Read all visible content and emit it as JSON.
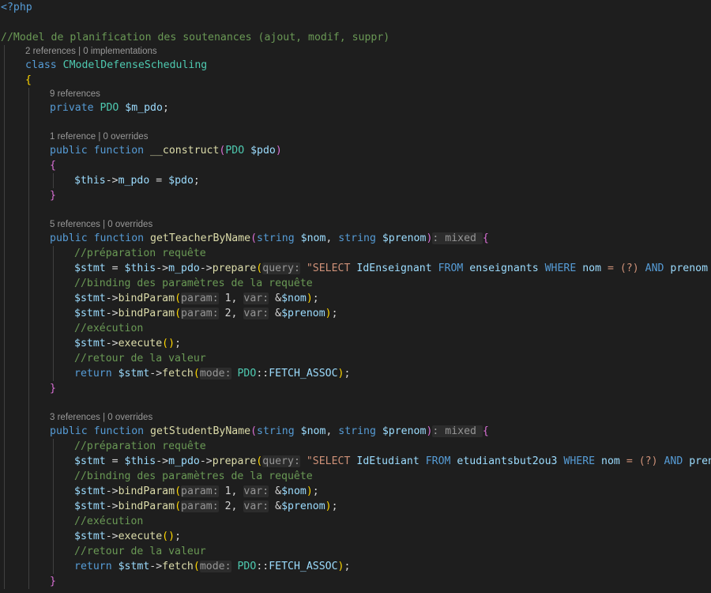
{
  "colors": {
    "background": "#1e1e1e",
    "plain": "#d4d4d4",
    "keyword": "#569cd6",
    "type": "#4ec9b0",
    "function": "#dcdcaa",
    "variable": "#9cdcfe",
    "string": "#ce9178",
    "comment": "#6a9955",
    "brace": "#ffd700",
    "paren": "#da70d6",
    "hint": "#969696",
    "lens": "#999999",
    "guide": "#404040"
  },
  "lines": [
    {
      "indent": 0,
      "kind": "code",
      "tokens": [
        {
          "t": "<?php",
          "c": "keyword"
        }
      ]
    },
    {
      "indent": 0,
      "kind": "blank",
      "tokens": []
    },
    {
      "indent": 0,
      "kind": "code",
      "tokens": [
        {
          "t": "//Model de planification des soutenances (ajout, modif, suppr)",
          "c": "comment"
        }
      ]
    },
    {
      "indent": 1,
      "kind": "lens",
      "text": "2 references | 0 implementations"
    },
    {
      "indent": 1,
      "kind": "code",
      "tokens": [
        {
          "t": "class ",
          "c": "keyword"
        },
        {
          "t": "CModelDefenseScheduling",
          "c": "type"
        }
      ]
    },
    {
      "indent": 1,
      "kind": "code",
      "tokens": [
        {
          "t": "{",
          "c": "brace"
        }
      ]
    },
    {
      "indent": 2,
      "kind": "lens",
      "text": "9 references"
    },
    {
      "indent": 2,
      "kind": "code",
      "tokens": [
        {
          "t": "private ",
          "c": "keyword"
        },
        {
          "t": "PDO ",
          "c": "type"
        },
        {
          "t": "$m_pdo",
          "c": "variable"
        },
        {
          "t": ";",
          "c": "plain"
        }
      ]
    },
    {
      "indent": 0,
      "kind": "blank",
      "tokens": []
    },
    {
      "indent": 2,
      "kind": "lens",
      "text": "1 reference | 0 overrides"
    },
    {
      "indent": 2,
      "kind": "code",
      "tokens": [
        {
          "t": "public ",
          "c": "keyword"
        },
        {
          "t": "function ",
          "c": "keyword"
        },
        {
          "t": "__construct",
          "c": "function"
        },
        {
          "t": "(",
          "c": "paren"
        },
        {
          "t": "PDO ",
          "c": "type"
        },
        {
          "t": "$pdo",
          "c": "variable"
        },
        {
          "t": ")",
          "c": "paren"
        }
      ]
    },
    {
      "indent": 2,
      "kind": "code",
      "tokens": [
        {
          "t": "{",
          "c": "paren"
        }
      ]
    },
    {
      "indent": 3,
      "kind": "code",
      "tokens": [
        {
          "t": "$this",
          "c": "variable"
        },
        {
          "t": "->",
          "c": "plain"
        },
        {
          "t": "m_pdo",
          "c": "variable"
        },
        {
          "t": " = ",
          "c": "plain"
        },
        {
          "t": "$pdo",
          "c": "variable"
        },
        {
          "t": ";",
          "c": "plain"
        }
      ]
    },
    {
      "indent": 2,
      "kind": "code",
      "tokens": [
        {
          "t": "}",
          "c": "paren"
        }
      ]
    },
    {
      "indent": 0,
      "kind": "blank",
      "tokens": []
    },
    {
      "indent": 2,
      "kind": "lens",
      "text": "5 references | 0 overrides"
    },
    {
      "indent": 2,
      "kind": "code",
      "tokens": [
        {
          "t": "public ",
          "c": "keyword"
        },
        {
          "t": "function ",
          "c": "keyword"
        },
        {
          "t": "getTeacherByName",
          "c": "function"
        },
        {
          "t": "(",
          "c": "paren"
        },
        {
          "t": "string ",
          "c": "keyword"
        },
        {
          "t": "$nom",
          "c": "variable"
        },
        {
          "t": ", ",
          "c": "plain"
        },
        {
          "t": "string ",
          "c": "keyword"
        },
        {
          "t": "$prenom",
          "c": "variable"
        },
        {
          "t": ")",
          "c": "paren"
        },
        {
          "t": ": mixed ",
          "c": "hint"
        },
        {
          "t": "{",
          "c": "paren"
        }
      ]
    },
    {
      "indent": 3,
      "kind": "code",
      "tokens": [
        {
          "t": "//préparation requête",
          "c": "comment"
        }
      ]
    },
    {
      "indent": 3,
      "kind": "code",
      "tokens": [
        {
          "t": "$stmt",
          "c": "variable"
        },
        {
          "t": " = ",
          "c": "plain"
        },
        {
          "t": "$this",
          "c": "variable"
        },
        {
          "t": "->",
          "c": "plain"
        },
        {
          "t": "m_pdo",
          "c": "variable"
        },
        {
          "t": "->",
          "c": "plain"
        },
        {
          "t": "prepare",
          "c": "function"
        },
        {
          "t": "(",
          "c": "brace"
        },
        {
          "t": "query:",
          "c": "hint"
        },
        {
          "t": " ",
          "c": "plain"
        },
        {
          "t": "\"SELECT ",
          "c": "string"
        },
        {
          "t": "IdEnseignant ",
          "c": "variable"
        },
        {
          "t": "FROM ",
          "c": "keyword"
        },
        {
          "t": "enseignants ",
          "c": "variable"
        },
        {
          "t": "WHERE ",
          "c": "keyword"
        },
        {
          "t": "nom ",
          "c": "variable"
        },
        {
          "t": "= (?) ",
          "c": "string"
        },
        {
          "t": "AND ",
          "c": "keyword"
        },
        {
          "t": "prenom ",
          "c": "variable"
        },
        {
          "t": "=(?)\");",
          "c": "string"
        }
      ]
    },
    {
      "indent": 3,
      "kind": "code",
      "tokens": [
        {
          "t": "//binding des paramètres de la requête",
          "c": "comment"
        }
      ]
    },
    {
      "indent": 3,
      "kind": "code",
      "tokens": [
        {
          "t": "$stmt",
          "c": "variable"
        },
        {
          "t": "->",
          "c": "plain"
        },
        {
          "t": "bindParam",
          "c": "function"
        },
        {
          "t": "(",
          "c": "brace"
        },
        {
          "t": "param:",
          "c": "hint"
        },
        {
          "t": " 1, ",
          "c": "plain"
        },
        {
          "t": "var:",
          "c": "hint"
        },
        {
          "t": " &",
          "c": "plain"
        },
        {
          "t": "$nom",
          "c": "variable"
        },
        {
          "t": ")",
          "c": "brace"
        },
        {
          "t": ";",
          "c": "plain"
        }
      ]
    },
    {
      "indent": 3,
      "kind": "code",
      "tokens": [
        {
          "t": "$stmt",
          "c": "variable"
        },
        {
          "t": "->",
          "c": "plain"
        },
        {
          "t": "bindParam",
          "c": "function"
        },
        {
          "t": "(",
          "c": "brace"
        },
        {
          "t": "param:",
          "c": "hint"
        },
        {
          "t": " 2, ",
          "c": "plain"
        },
        {
          "t": "var:",
          "c": "hint"
        },
        {
          "t": " &",
          "c": "plain"
        },
        {
          "t": "$prenom",
          "c": "variable"
        },
        {
          "t": ")",
          "c": "brace"
        },
        {
          "t": ";",
          "c": "plain"
        }
      ]
    },
    {
      "indent": 3,
      "kind": "code",
      "tokens": [
        {
          "t": "//exécution",
          "c": "comment"
        }
      ]
    },
    {
      "indent": 3,
      "kind": "code",
      "tokens": [
        {
          "t": "$stmt",
          "c": "variable"
        },
        {
          "t": "->",
          "c": "plain"
        },
        {
          "t": "execute",
          "c": "function"
        },
        {
          "t": "()",
          "c": "brace"
        },
        {
          "t": ";",
          "c": "plain"
        }
      ]
    },
    {
      "indent": 3,
      "kind": "code",
      "tokens": [
        {
          "t": "//retour de la valeur",
          "c": "comment"
        }
      ]
    },
    {
      "indent": 3,
      "kind": "code",
      "tokens": [
        {
          "t": "return ",
          "c": "keyword"
        },
        {
          "t": "$stmt",
          "c": "variable"
        },
        {
          "t": "->",
          "c": "plain"
        },
        {
          "t": "fetch",
          "c": "function"
        },
        {
          "t": "(",
          "c": "brace"
        },
        {
          "t": "mode:",
          "c": "hint"
        },
        {
          "t": " ",
          "c": "plain"
        },
        {
          "t": "PDO",
          "c": "type"
        },
        {
          "t": "::",
          "c": "plain"
        },
        {
          "t": "FETCH_ASSOC",
          "c": "variable"
        },
        {
          "t": ")",
          "c": "brace"
        },
        {
          "t": ";",
          "c": "plain"
        }
      ]
    },
    {
      "indent": 2,
      "kind": "code",
      "tokens": [
        {
          "t": "}",
          "c": "paren"
        }
      ]
    },
    {
      "indent": 0,
      "kind": "blank",
      "tokens": []
    },
    {
      "indent": 2,
      "kind": "lens",
      "text": "3 references | 0 overrides"
    },
    {
      "indent": 2,
      "kind": "code",
      "tokens": [
        {
          "t": "public ",
          "c": "keyword"
        },
        {
          "t": "function ",
          "c": "keyword"
        },
        {
          "t": "getStudentByName",
          "c": "function"
        },
        {
          "t": "(",
          "c": "paren"
        },
        {
          "t": "string ",
          "c": "keyword"
        },
        {
          "t": "$nom",
          "c": "variable"
        },
        {
          "t": ", ",
          "c": "plain"
        },
        {
          "t": "string ",
          "c": "keyword"
        },
        {
          "t": "$prenom",
          "c": "variable"
        },
        {
          "t": ")",
          "c": "paren"
        },
        {
          "t": ": mixed ",
          "c": "hint"
        },
        {
          "t": "{",
          "c": "paren"
        }
      ]
    },
    {
      "indent": 3,
      "kind": "code",
      "tokens": [
        {
          "t": "//préparation requête",
          "c": "comment"
        }
      ]
    },
    {
      "indent": 3,
      "kind": "code",
      "tokens": [
        {
          "t": "$stmt",
          "c": "variable"
        },
        {
          "t": " = ",
          "c": "plain"
        },
        {
          "t": "$this",
          "c": "variable"
        },
        {
          "t": "->",
          "c": "plain"
        },
        {
          "t": "m_pdo",
          "c": "variable"
        },
        {
          "t": "->",
          "c": "plain"
        },
        {
          "t": "prepare",
          "c": "function"
        },
        {
          "t": "(",
          "c": "brace"
        },
        {
          "t": "query:",
          "c": "hint"
        },
        {
          "t": " ",
          "c": "plain"
        },
        {
          "t": "\"SELECT ",
          "c": "string"
        },
        {
          "t": "IdEtudiant ",
          "c": "variable"
        },
        {
          "t": "FROM ",
          "c": "keyword"
        },
        {
          "t": "etudiantsbut2ou3 ",
          "c": "variable"
        },
        {
          "t": "WHERE ",
          "c": "keyword"
        },
        {
          "t": "nom ",
          "c": "variable"
        },
        {
          "t": "= (?) ",
          "c": "string"
        },
        {
          "t": "AND ",
          "c": "keyword"
        },
        {
          "t": "prenom ",
          "c": "variable"
        },
        {
          "t": "=(?)\");",
          "c": "string"
        }
      ]
    },
    {
      "indent": 3,
      "kind": "code",
      "tokens": [
        {
          "t": "//binding des paramètres de la requête",
          "c": "comment"
        }
      ]
    },
    {
      "indent": 3,
      "kind": "code",
      "tokens": [
        {
          "t": "$stmt",
          "c": "variable"
        },
        {
          "t": "->",
          "c": "plain"
        },
        {
          "t": "bindParam",
          "c": "function"
        },
        {
          "t": "(",
          "c": "brace"
        },
        {
          "t": "param:",
          "c": "hint"
        },
        {
          "t": " 1, ",
          "c": "plain"
        },
        {
          "t": "var:",
          "c": "hint"
        },
        {
          "t": " &",
          "c": "plain"
        },
        {
          "t": "$nom",
          "c": "variable"
        },
        {
          "t": ")",
          "c": "brace"
        },
        {
          "t": ";",
          "c": "plain"
        }
      ]
    },
    {
      "indent": 3,
      "kind": "code",
      "tokens": [
        {
          "t": "$stmt",
          "c": "variable"
        },
        {
          "t": "->",
          "c": "plain"
        },
        {
          "t": "bindParam",
          "c": "function"
        },
        {
          "t": "(",
          "c": "brace"
        },
        {
          "t": "param:",
          "c": "hint"
        },
        {
          "t": " 2, ",
          "c": "plain"
        },
        {
          "t": "var:",
          "c": "hint"
        },
        {
          "t": " &",
          "c": "plain"
        },
        {
          "t": "$prenom",
          "c": "variable"
        },
        {
          "t": ")",
          "c": "brace"
        },
        {
          "t": ";",
          "c": "plain"
        }
      ]
    },
    {
      "indent": 3,
      "kind": "code",
      "tokens": [
        {
          "t": "//exécution",
          "c": "comment"
        }
      ]
    },
    {
      "indent": 3,
      "kind": "code",
      "tokens": [
        {
          "t": "$stmt",
          "c": "variable"
        },
        {
          "t": "->",
          "c": "plain"
        },
        {
          "t": "execute",
          "c": "function"
        },
        {
          "t": "()",
          "c": "brace"
        },
        {
          "t": ";",
          "c": "plain"
        }
      ]
    },
    {
      "indent": 3,
      "kind": "code",
      "tokens": [
        {
          "t": "//retour de la valeur",
          "c": "comment"
        }
      ]
    },
    {
      "indent": 3,
      "kind": "code",
      "tokens": [
        {
          "t": "return ",
          "c": "keyword"
        },
        {
          "t": "$stmt",
          "c": "variable"
        },
        {
          "t": "->",
          "c": "plain"
        },
        {
          "t": "fetch",
          "c": "function"
        },
        {
          "t": "(",
          "c": "brace"
        },
        {
          "t": "mode:",
          "c": "hint"
        },
        {
          "t": " ",
          "c": "plain"
        },
        {
          "t": "PDO",
          "c": "type"
        },
        {
          "t": "::",
          "c": "plain"
        },
        {
          "t": "FETCH_ASSOC",
          "c": "variable"
        },
        {
          "t": ")",
          "c": "brace"
        },
        {
          "t": ";",
          "c": "plain"
        }
      ]
    },
    {
      "indent": 2,
      "kind": "code",
      "tokens": [
        {
          "t": "}",
          "c": "paren"
        }
      ]
    }
  ]
}
